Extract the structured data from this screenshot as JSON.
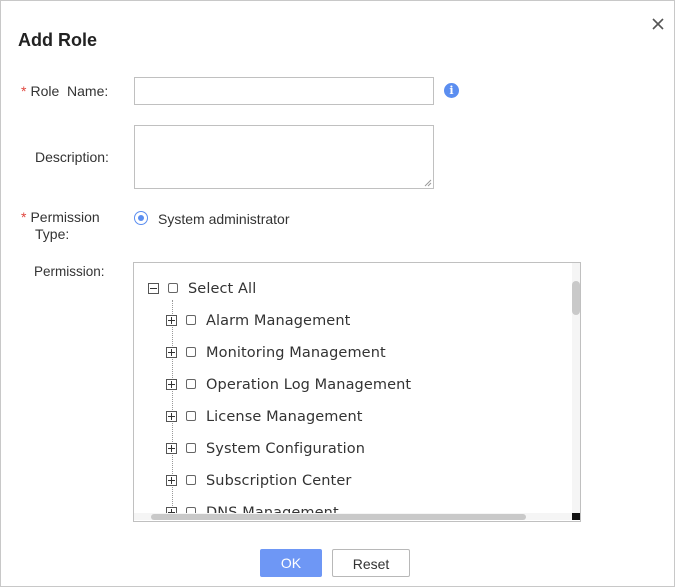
{
  "dialog": {
    "title": "Add Role",
    "close_icon": "close-icon"
  },
  "form": {
    "required_marker": "*",
    "role_name_label": "Role  Name:",
    "role_name_value": "",
    "info_icon": "info-icon",
    "info_glyph": "i",
    "description_label": "Description:",
    "description_value": "",
    "permission_type_label_line1": "Permission",
    "permission_type_label_line2": "Type:",
    "permission_type_option": "System administrator",
    "permission_label": "Permission:"
  },
  "tree": {
    "root": {
      "label": "Select All",
      "expanded": true,
      "checked": false
    },
    "items": [
      {
        "label": "Alarm Management",
        "expanded": false,
        "checked": false
      },
      {
        "label": "Monitoring Management",
        "expanded": false,
        "checked": false
      },
      {
        "label": "Operation Log Management",
        "expanded": false,
        "checked": false
      },
      {
        "label": "License Management",
        "expanded": false,
        "checked": false
      },
      {
        "label": "System Configuration",
        "expanded": false,
        "checked": false
      },
      {
        "label": "Subscription Center",
        "expanded": false,
        "checked": false
      },
      {
        "label": "DNS Management",
        "expanded": false,
        "checked": false
      }
    ]
  },
  "buttons": {
    "ok_label": "OK",
    "reset_label": "Reset"
  },
  "colors": {
    "accent": "#5b8ef0",
    "primary_button": "#6e97f5",
    "required": "#e0463e"
  }
}
